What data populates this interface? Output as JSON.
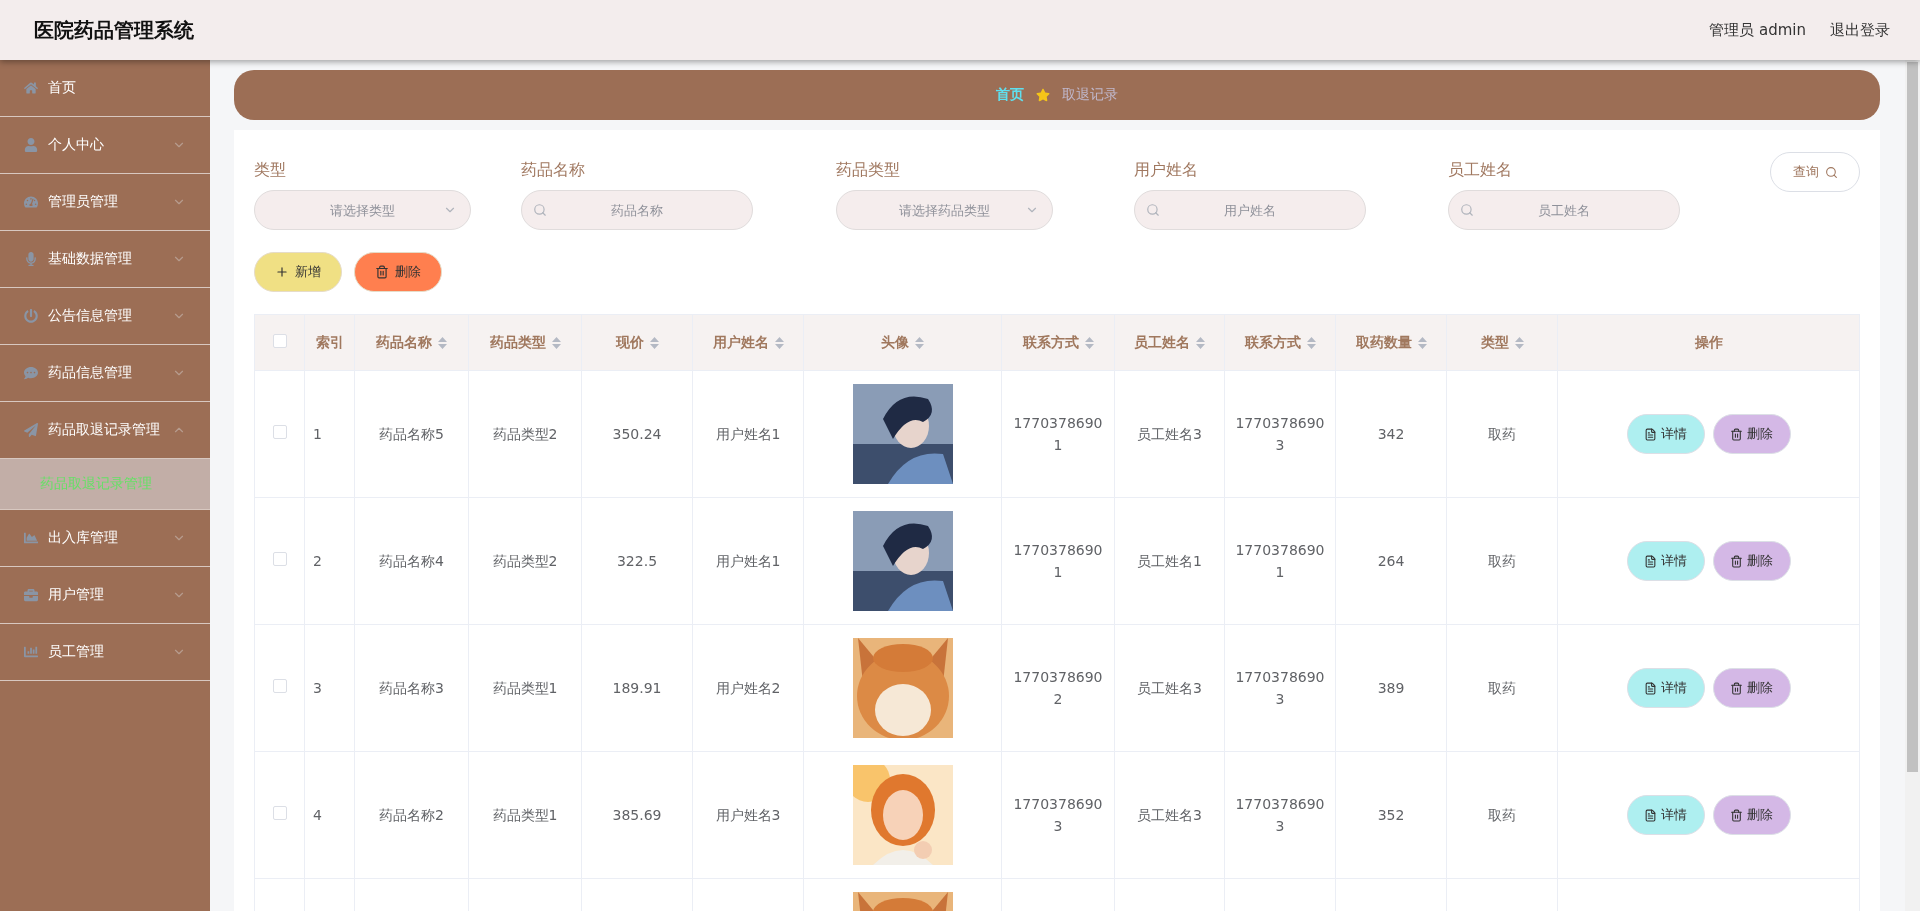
{
  "app": {
    "title": "医院药品管理系统",
    "user_label": "管理员 admin",
    "logout": "退出登录"
  },
  "sidebar": {
    "items": [
      {
        "label": "首页",
        "kind": "link"
      },
      {
        "label": "个人中心",
        "kind": "menu",
        "expanded": false
      },
      {
        "label": "管理员管理",
        "kind": "menu",
        "expanded": false
      },
      {
        "label": "基础数据管理",
        "kind": "menu",
        "expanded": false
      },
      {
        "label": "公告信息管理",
        "kind": "menu",
        "expanded": false
      },
      {
        "label": "药品信息管理",
        "kind": "menu",
        "expanded": false
      },
      {
        "label": "药品取退记录管理",
        "kind": "menu",
        "expanded": true,
        "children": [
          {
            "label": "药品取退记录管理",
            "selected": true
          }
        ]
      },
      {
        "label": "出入库管理",
        "kind": "menu",
        "expanded": false
      },
      {
        "label": "用户管理",
        "kind": "menu",
        "expanded": false
      },
      {
        "label": "员工管理",
        "kind": "menu",
        "expanded": false
      }
    ]
  },
  "breadcrumb": [
    {
      "label": "首页",
      "current": false
    },
    {
      "label": "取退记录",
      "current": true
    }
  ],
  "filters": [
    {
      "label": "类型",
      "kind": "select",
      "placeholder": "请选择类型"
    },
    {
      "label": "药品名称",
      "kind": "search",
      "placeholder": "药品名称"
    },
    {
      "label": "药品类型",
      "kind": "select",
      "placeholder": "请选择药品类型"
    },
    {
      "label": "用户姓名",
      "kind": "search",
      "placeholder": "用户姓名"
    },
    {
      "label": "员工姓名",
      "kind": "search",
      "placeholder": "员工姓名"
    }
  ],
  "query_button": "查询",
  "actions": [
    {
      "label": "新增",
      "kind": "add"
    },
    {
      "label": "删除",
      "kind": "delete"
    }
  ],
  "table": {
    "all_checked": false,
    "columns": [
      {
        "label": "索引",
        "sortable": false
      },
      {
        "label": "药品名称",
        "sortable": true
      },
      {
        "label": "药品类型",
        "sortable": true
      },
      {
        "label": "现价",
        "sortable": true
      },
      {
        "label": "用户姓名",
        "sortable": true
      },
      {
        "label": "头像",
        "sortable": true
      },
      {
        "label": "联系方式",
        "sortable": true
      },
      {
        "label": "员工姓名",
        "sortable": true
      },
      {
        "label": "联系方式",
        "sortable": true
      },
      {
        "label": "取药数量",
        "sortable": true
      },
      {
        "label": "类型",
        "sortable": true
      },
      {
        "label": "操作",
        "sortable": false
      }
    ],
    "rows": [
      {
        "checked": false,
        "index": "1",
        "drug_name": "药品名称5",
        "drug_type": "药品类型2",
        "price": "350.24",
        "user_name": "用户姓名1",
        "avatar": {
          "kind": "picture"
        },
        "user_phone": "17703786901",
        "staff_name": "员工姓名3",
        "staff_phone": "17703786903",
        "quantity": "342",
        "type": "取药",
        "actions": [
          {
            "label": "详情",
            "kind": "detail"
          },
          {
            "label": "删除",
            "kind": "delete"
          }
        ]
      },
      {
        "checked": false,
        "index": "2",
        "drug_name": "药品名称4",
        "drug_type": "药品类型2",
        "price": "322.5",
        "user_name": "用户姓名1",
        "avatar": {
          "kind": "picture"
        },
        "user_phone": "17703786901",
        "staff_name": "员工姓名1",
        "staff_phone": "17703786901",
        "quantity": "264",
        "type": "取药",
        "actions": [
          {
            "label": "详情",
            "kind": "detail"
          },
          {
            "label": "删除",
            "kind": "delete"
          }
        ]
      },
      {
        "checked": false,
        "index": "3",
        "drug_name": "药品名称3",
        "drug_type": "药品类型1",
        "price": "189.91",
        "user_name": "用户姓名2",
        "avatar": {
          "kind": "picture"
        },
        "user_phone": "17703786902",
        "staff_name": "员工姓名3",
        "staff_phone": "17703786903",
        "quantity": "389",
        "type": "取药",
        "actions": [
          {
            "label": "详情",
            "kind": "detail"
          },
          {
            "label": "删除",
            "kind": "delete"
          }
        ]
      },
      {
        "checked": false,
        "index": "4",
        "drug_name": "药品名称2",
        "drug_type": "药品类型1",
        "price": "385.69",
        "user_name": "用户姓名3",
        "avatar": {
          "kind": "picture"
        },
        "user_phone": "17703786903",
        "staff_name": "员工姓名3",
        "staff_phone": "17703786903",
        "quantity": "352",
        "type": "取药",
        "actions": [
          {
            "label": "详情",
            "kind": "detail"
          },
          {
            "label": "删除",
            "kind": "delete"
          }
        ]
      },
      {
        "avatar": {
          "kind": "picture"
        }
      }
    ]
  }
}
